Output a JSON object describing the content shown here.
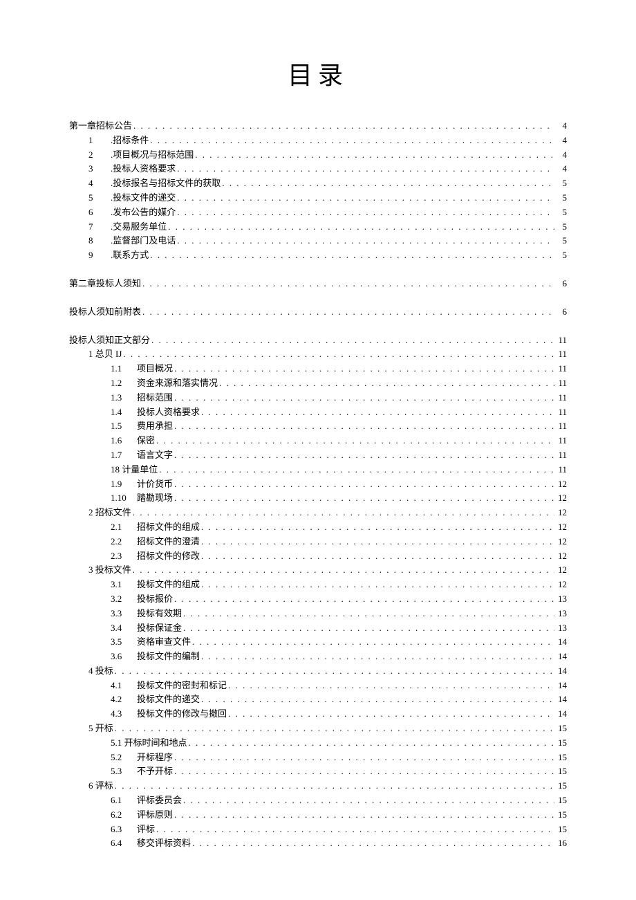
{
  "title": "目录",
  "toc": [
    {
      "indent": 0,
      "num": "",
      "label": "第一章招标公告",
      "page": "4",
      "spaced_after": false
    },
    {
      "indent": 1,
      "num": "1",
      "label": ".招标条件",
      "page": "4",
      "spaced_after": false
    },
    {
      "indent": 1,
      "num": "2",
      "label": ".项目概况与招标范围",
      "page": "4",
      "spaced_after": false
    },
    {
      "indent": 1,
      "num": "3",
      "label": ".投标人资格要求",
      "page": "4",
      "spaced_after": false
    },
    {
      "indent": 1,
      "num": "4",
      "label": ".投标报名与招标文件的获取",
      "page": "5",
      "spaced_after": false
    },
    {
      "indent": 1,
      "num": "5",
      "label": ".投标文件的递交",
      "page": "5",
      "spaced_after": false
    },
    {
      "indent": 1,
      "num": "6",
      "label": ".发布公告的媒介",
      "page": "5",
      "spaced_after": false
    },
    {
      "indent": 1,
      "num": "7",
      "label": ".交易服务单位",
      "page": "5",
      "spaced_after": false
    },
    {
      "indent": 1,
      "num": "8",
      "label": ".监督部门及电话",
      "page": "5",
      "spaced_after": false
    },
    {
      "indent": 1,
      "num": "9",
      "label": ".联系方式",
      "page": "5",
      "spaced_after": true
    },
    {
      "indent": 0,
      "num": "",
      "label": "第二章投标人须知",
      "page": "6",
      "spaced_after": true
    },
    {
      "indent": 0,
      "num": "",
      "label": "投标人须知前附表",
      "page": "6",
      "spaced_after": true
    },
    {
      "indent": 0,
      "num": "",
      "label": "投标人须知正文部分",
      "page": "11",
      "spaced_after": false
    },
    {
      "indent": 1,
      "num": "",
      "label": "1 总贝 IJ",
      "page": "11",
      "spaced_after": false
    },
    {
      "indent": 2,
      "num": "1.1",
      "label": "项目概况",
      "page": "11",
      "spaced_after": false
    },
    {
      "indent": 2,
      "num": "1.2",
      "label": "资金来源和落实情况",
      "page": "11",
      "spaced_after": false
    },
    {
      "indent": 2,
      "num": "1.3",
      "label": "招标范围",
      "page": "11",
      "spaced_after": false
    },
    {
      "indent": 2,
      "num": "1.4",
      "label": "投标人资格要求",
      "page": "11",
      "spaced_after": false
    },
    {
      "indent": 2,
      "num": "1.5",
      "label": "费用承担",
      "page": "11",
      "spaced_after": false
    },
    {
      "indent": 2,
      "num": "1.6",
      "label": "保密",
      "page": "11",
      "spaced_after": false
    },
    {
      "indent": 2,
      "num": "1.7",
      "label": "语言文字",
      "page": "11",
      "spaced_after": false
    },
    {
      "indent": 2,
      "num": "",
      "label": "18 计量单位",
      "page": "11",
      "spaced_after": false
    },
    {
      "indent": 2,
      "num": "1.9",
      "label": "计价货币",
      "page": "12",
      "spaced_after": false
    },
    {
      "indent": 2,
      "num": "1.10",
      "label": "踏勘现场",
      "page": "12",
      "spaced_after": false
    },
    {
      "indent": 1,
      "num": "",
      "label": "2 招标文件",
      "page": "12",
      "spaced_after": false
    },
    {
      "indent": 2,
      "num": "2.1",
      "label": "招标文件的组成",
      "page": "12",
      "spaced_after": false
    },
    {
      "indent": 2,
      "num": "2.2",
      "label": "招标文件的澄清",
      "page": "12",
      "spaced_after": false
    },
    {
      "indent": 2,
      "num": "2.3",
      "label": "招标文件的修改",
      "page": "12",
      "spaced_after": false
    },
    {
      "indent": 1,
      "num": "",
      "label": "3 投标文件",
      "page": "12",
      "spaced_after": false
    },
    {
      "indent": 2,
      "num": "3.1",
      "label": "投标文件的组成",
      "page": "12",
      "spaced_after": false
    },
    {
      "indent": 2,
      "num": "3.2",
      "label": "投标报价",
      "page": "13",
      "spaced_after": false
    },
    {
      "indent": 2,
      "num": "3.3",
      "label": "投标有效期",
      "page": "13",
      "spaced_after": false
    },
    {
      "indent": 2,
      "num": "3.4",
      "label": "投标保证金",
      "page": "13",
      "spaced_after": false
    },
    {
      "indent": 2,
      "num": "3.5",
      "label": "资格审查文件",
      "page": "14",
      "spaced_after": false
    },
    {
      "indent": 2,
      "num": "3.6",
      "label": "投标文件的编制",
      "page": "14",
      "spaced_after": false
    },
    {
      "indent": 1,
      "num": "",
      "label": "4 投标",
      "page": "14",
      "spaced_after": false
    },
    {
      "indent": 2,
      "num": "4.1",
      "label": "投标文件的密封和标记",
      "page": "14",
      "spaced_after": false
    },
    {
      "indent": 2,
      "num": "4.2",
      "label": "投标文件的递交",
      "page": "14",
      "spaced_after": false
    },
    {
      "indent": 2,
      "num": "4.3",
      "label": "投标文件的修改与撤回",
      "page": "14",
      "spaced_after": false
    },
    {
      "indent": 1,
      "num": "",
      "label": "5 开标",
      "page": "15",
      "spaced_after": false
    },
    {
      "indent": 2,
      "num": "",
      "label": "5.1 开标时间和地点",
      "page": "15",
      "spaced_after": false
    },
    {
      "indent": 2,
      "num": "5.2",
      "label": "开标程序",
      "page": "15",
      "spaced_after": false
    },
    {
      "indent": 2,
      "num": "5.3",
      "label": "不予开标",
      "page": "15",
      "spaced_after": false
    },
    {
      "indent": 1,
      "num": "",
      "label": "6 评标",
      "page": "15",
      "spaced_after": false
    },
    {
      "indent": 2,
      "num": "6.1",
      "label": "评标委员会",
      "page": "15",
      "spaced_after": false
    },
    {
      "indent": 2,
      "num": "6.2",
      "label": "评标原则",
      "page": "15",
      "spaced_after": false
    },
    {
      "indent": 2,
      "num": "6.3",
      "label": "评标",
      "page": "15",
      "spaced_after": false
    },
    {
      "indent": 2,
      "num": "6.4",
      "label": "移交评标资料",
      "page": "16",
      "spaced_after": false
    }
  ]
}
